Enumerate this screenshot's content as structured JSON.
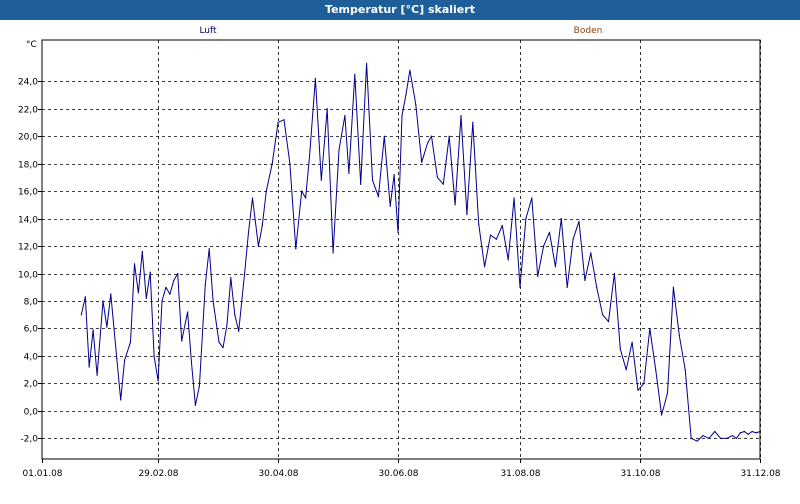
{
  "window": {
    "title": "Temperatur [°C] skaliert"
  },
  "colors": {
    "title_bg": "#1f5f99",
    "series_luft": "#00008b",
    "series_boden": "#8b4513",
    "grid": "#000000"
  },
  "chart_data": {
    "type": "line",
    "title": "Temperatur [°C] skaliert",
    "ylabel": "°C",
    "xlabel": "",
    "grid": true,
    "legend_placement": "top",
    "ylim": [
      -3.5,
      27.0
    ],
    "xlim": [
      "2008-01-01",
      "2008-12-31"
    ],
    "x_ticks": [
      "01.01.08",
      "29.02.08",
      "30.04.08",
      "30.06.08",
      "31.08.08",
      "31.10.08",
      "31.12.08"
    ],
    "y_ticks": [
      "-2,0",
      "0,0",
      "2,0",
      "4,0",
      "6,0",
      "8,0",
      "10,0",
      "12,0",
      "14,0",
      "16,0",
      "18,0",
      "20,0",
      "22,0",
      "24,0"
    ],
    "series": [
      {
        "name": "Luft",
        "color": "#00008b",
        "x": [
          "2008-01-21",
          "2008-01-23",
          "2008-01-25",
          "2008-01-27",
          "2008-01-29",
          "2008-02-01",
          "2008-02-03",
          "2008-02-05",
          "2008-02-08",
          "2008-02-10",
          "2008-02-12",
          "2008-02-15",
          "2008-02-17",
          "2008-02-19",
          "2008-02-21",
          "2008-02-23",
          "2008-02-25",
          "2008-02-27",
          "2008-02-29",
          "2008-03-02",
          "2008-03-04",
          "2008-03-06",
          "2008-03-08",
          "2008-03-10",
          "2008-03-12",
          "2008-03-15",
          "2008-03-17",
          "2008-03-19",
          "2008-03-21",
          "2008-03-24",
          "2008-03-26",
          "2008-03-28",
          "2008-03-31",
          "2008-04-02",
          "2008-04-04",
          "2008-04-06",
          "2008-04-08",
          "2008-04-10",
          "2008-04-13",
          "2008-04-15",
          "2008-04-17",
          "2008-04-20",
          "2008-04-22",
          "2008-04-24",
          "2008-04-27",
          "2008-04-30",
          "2008-05-03",
          "2008-05-06",
          "2008-05-09",
          "2008-05-12",
          "2008-05-14",
          "2008-05-16",
          "2008-05-19",
          "2008-05-22",
          "2008-05-25",
          "2008-05-28",
          "2008-05-31",
          "2008-06-03",
          "2008-06-05",
          "2008-06-08",
          "2008-06-11",
          "2008-06-14",
          "2008-06-17",
          "2008-06-20",
          "2008-06-23",
          "2008-06-26",
          "2008-06-28",
          "2008-06-30",
          "2008-07-02",
          "2008-07-04",
          "2008-07-06",
          "2008-07-09",
          "2008-07-12",
          "2008-07-15",
          "2008-07-17",
          "2008-07-20",
          "2008-07-23",
          "2008-07-26",
          "2008-07-29",
          "2008-08-01",
          "2008-08-04",
          "2008-08-07",
          "2008-08-10",
          "2008-08-13",
          "2008-08-16",
          "2008-08-19",
          "2008-08-22",
          "2008-08-25",
          "2008-08-28",
          "2008-08-31",
          "2008-09-03",
          "2008-09-06",
          "2008-09-09",
          "2008-09-12",
          "2008-09-15",
          "2008-09-18",
          "2008-09-21",
          "2008-09-24",
          "2008-09-27",
          "2008-09-30",
          "2008-10-03",
          "2008-10-06",
          "2008-10-09",
          "2008-10-12",
          "2008-10-15",
          "2008-10-18",
          "2008-10-21",
          "2008-10-24",
          "2008-10-27",
          "2008-10-30",
          "2008-11-02",
          "2008-11-05",
          "2008-11-08",
          "2008-11-11",
          "2008-11-14",
          "2008-11-17",
          "2008-11-20",
          "2008-11-23",
          "2008-11-26",
          "2008-11-29",
          "2008-12-02",
          "2008-12-05",
          "2008-12-08",
          "2008-12-11",
          "2008-12-14",
          "2008-12-17",
          "2008-12-19",
          "2008-12-21",
          "2008-12-23",
          "2008-12-25",
          "2008-12-27",
          "2008-12-29",
          "2008-12-31"
        ],
        "y": [
          7.0,
          8.3,
          3.2,
          5.9,
          2.6,
          8.0,
          6.1,
          8.5,
          3.8,
          0.8,
          3.7,
          5.0,
          10.7,
          8.6,
          11.6,
          8.2,
          10.1,
          4.0,
          2.2,
          8.0,
          9.0,
          8.5,
          9.5,
          10.0,
          5.1,
          7.2,
          3.5,
          0.4,
          1.8,
          9.2,
          11.8,
          8.0,
          5.0,
          4.6,
          6.2,
          9.7,
          7.0,
          5.8,
          10.0,
          13.0,
          15.5,
          12.0,
          13.5,
          16.0,
          18.0,
          21.0,
          21.2,
          18.0,
          11.8,
          16.0,
          15.5,
          18.5,
          24.2,
          16.8,
          22.0,
          11.5,
          19.0,
          21.5,
          17.3,
          24.5,
          16.5,
          25.3,
          16.8,
          15.6,
          20.0,
          14.9,
          17.2,
          13.0,
          21.5,
          23.0,
          24.8,
          22.3,
          18.1,
          19.5,
          20.0,
          17.0,
          16.5,
          20.0,
          15.0,
          21.5,
          14.3,
          21.0,
          13.6,
          10.5,
          12.8,
          12.5,
          13.5,
          11.0,
          15.5,
          9.0,
          14.0,
          15.5,
          9.8,
          12.0,
          13.0,
          10.5,
          14.0,
          9.0,
          12.5,
          13.8,
          9.5,
          11.5,
          9.0,
          7.0,
          6.5,
          10.0,
          4.5,
          3.0,
          5.0,
          1.5,
          2.0,
          6.0,
          3.0,
          -0.3,
          1.3,
          9.0,
          5.5,
          3.0,
          -2.0,
          -2.2,
          -1.8,
          -2.0,
          -1.5,
          -2.0,
          -2.0,
          -1.8,
          -2.0,
          -1.6,
          -1.5,
          -1.7,
          -1.5,
          -1.6,
          -1.5
        ]
      },
      {
        "name": "Boden",
        "color": "#8b4513",
        "x": [],
        "y": []
      }
    ]
  }
}
